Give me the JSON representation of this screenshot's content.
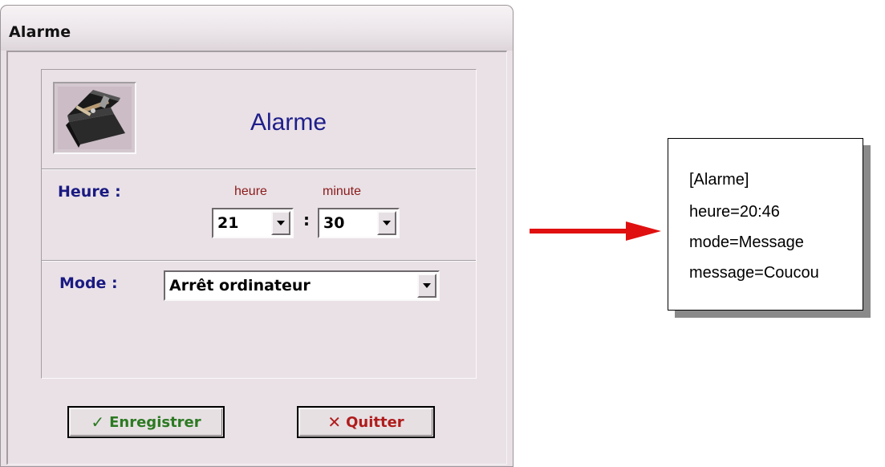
{
  "window": {
    "title": "Alarme"
  },
  "header": {
    "title": "Alarme",
    "icon": "toolbox-icon"
  },
  "heure": {
    "label": "Heure :",
    "hour_caption": "heure",
    "minute_caption": "minute",
    "hour_value": "21",
    "separator": ":",
    "minute_value": "30"
  },
  "mode": {
    "label": "Mode :",
    "selected": "Arrêt ordinateur"
  },
  "buttons": {
    "save_label": "Enregistrer",
    "save_icon": "✓",
    "quit_label": "Quitter",
    "quit_icon": "✕"
  },
  "ini_file": {
    "lines": [
      "[Alarme]",
      "heure=20:46",
      "mode=Message",
      "message=Coucou"
    ]
  },
  "colors": {
    "dialog_bg": "#e9e1e6",
    "label_blue": "#1a1a82",
    "caption_red": "#8b1a1a",
    "arrow_red": "#e01010",
    "save_green": "#2c7a22",
    "quit_red": "#b01c1c"
  }
}
